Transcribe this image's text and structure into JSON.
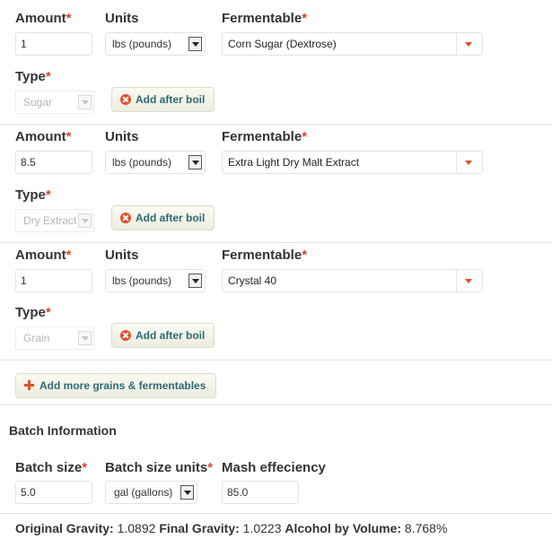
{
  "labels": {
    "amount": "Amount",
    "units": "Units",
    "fermentable": "Fermentable",
    "type": "Type",
    "required_mark": "*",
    "add_after_boil": "Add after boil"
  },
  "fermentables": [
    {
      "amount": "1",
      "units": "lbs (pounds)",
      "fermentable": "Corn Sugar (Dextrose)",
      "type": "Sugar"
    },
    {
      "amount": "8.5",
      "units": "lbs (pounds)",
      "fermentable": "Extra Light Dry Malt Extract",
      "type": "Dry Extract"
    },
    {
      "amount": "1",
      "units": "lbs (pounds)",
      "fermentable": "Crystal 40",
      "type": "Grain"
    }
  ],
  "add_more_label": "Add more grains & fermentables",
  "batch": {
    "section_title": "Batch Information",
    "size_label": "Batch size",
    "size_value": "5.0",
    "size_units_label": "Batch size units",
    "size_units_value": "gal (gallons)",
    "mash_label": "Mash effeciency",
    "mash_value": "85.0"
  },
  "summary": {
    "og_label": "Original Gravity:",
    "og_value": "1.0892",
    "fg_label": "Final Gravity:",
    "fg_value": "1.0223",
    "abv_label": "Alcohol by Volume:",
    "abv_value": "8.768%"
  },
  "colors": {
    "accent": "#e0502b",
    "button_text": "#2e6a73"
  },
  "icons": {
    "remove": "x-circle-icon",
    "add": "plus-icon",
    "dropdown": "chevron-down-icon"
  }
}
